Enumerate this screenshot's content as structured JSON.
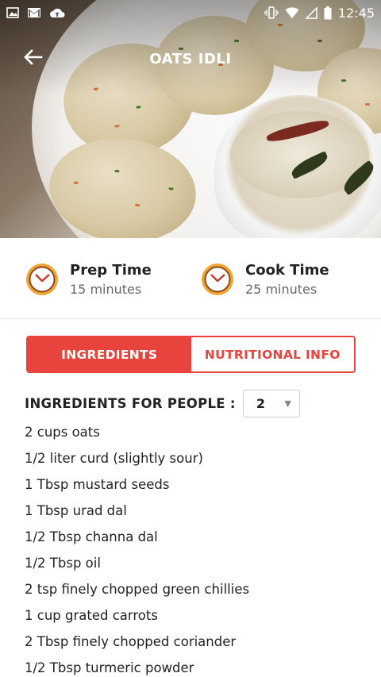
{
  "status_bar": {
    "time": "12:45",
    "left_icons": [
      "image-icon",
      "gmail-icon",
      "cloud-upload-icon"
    ],
    "right_icons": [
      "vibrate-icon",
      "wifi-icon",
      "signal-icon",
      "battery-icon"
    ]
  },
  "app_bar": {
    "title": "OATS IDLI",
    "back_icon": "arrow-left-icon"
  },
  "times": {
    "prep": {
      "label": "Prep Time",
      "value": "15 minutes",
      "icon": "clock-icon"
    },
    "cook": {
      "label": "Cook Time",
      "value": "25 minutes",
      "icon": "clock-icon"
    }
  },
  "tabs": [
    {
      "label": "INGREDIENTS",
      "active": true
    },
    {
      "label": "NUTRITIONAL INFO",
      "active": false
    }
  ],
  "people": {
    "label": "INGREDIENTS FOR PEOPLE :",
    "selected": "2"
  },
  "ingredients": [
    "2 cups oats",
    "1/2 liter curd (slightly sour)",
    "1 Tbsp mustard seeds",
    "1 Tbsp urad dal",
    "1/2 Tbsp channa dal",
    "1/2 Tbsp oil",
    "2 tsp finely chopped green chillies",
    "1 cup grated carrots",
    "2 Tbsp finely chopped coriander",
    "1/2 Tbsp turmeric powder"
  ],
  "colors": {
    "accent": "#e8433c",
    "clock_ring": "#f0a535"
  }
}
